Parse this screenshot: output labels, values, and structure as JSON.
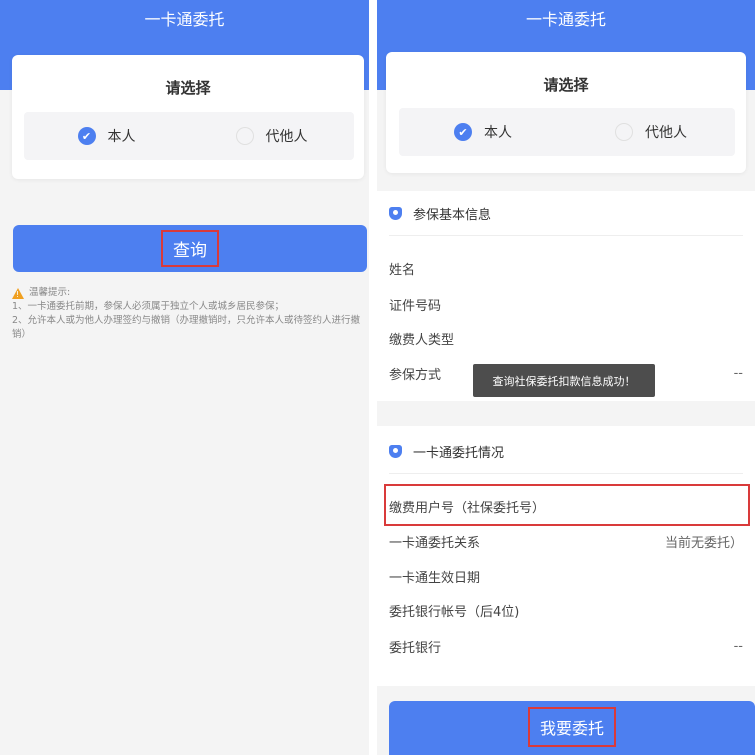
{
  "left": {
    "title": "一卡通委托",
    "select_heading": "请选择",
    "options": [
      {
        "label": "本人",
        "selected": true
      },
      {
        "label": "代他人",
        "selected": false
      }
    ],
    "query_button": "查询",
    "tips": {
      "head": "温馨提示:",
      "lines": [
        "1、一卡通委托前期，参保人必须属于独立个人或城乡居民参保；",
        "2、允许本人或为他人办理签约与撤销（办理撤销时，只允许本人或待签约人进行撤销）"
      ]
    }
  },
  "right": {
    "title": "一卡通委托",
    "select_heading": "请选择",
    "options": [
      {
        "label": "本人",
        "selected": true
      },
      {
        "label": "代他人",
        "selected": false
      }
    ],
    "basic_section": {
      "title": "参保基本信息",
      "fields": [
        {
          "label": "姓名",
          "value": ""
        },
        {
          "label": "证件号码",
          "value": ""
        },
        {
          "label": "缴费人类型",
          "value": ""
        },
        {
          "label": "参保方式",
          "value": "--"
        }
      ]
    },
    "toast": "查询社保委托扣款信息成功！",
    "entrust_section": {
      "title": "一卡通委托情况",
      "fields": [
        {
          "label": "缴费用户号（社保委托号）",
          "value": ""
        },
        {
          "label": "一卡通委托关系",
          "value": "当前无委托）"
        },
        {
          "label": "一卡通生效日期",
          "value": ""
        },
        {
          "label": "委托银行帐号（后4位)",
          "value": ""
        },
        {
          "label": "委托银行",
          "value": "--"
        }
      ]
    },
    "entrust_button": "我要委托"
  },
  "colors": {
    "brand_blue": "#4d7ff0",
    "highlight_red": "#d93a3a",
    "warning_orange": "#f0a020"
  }
}
